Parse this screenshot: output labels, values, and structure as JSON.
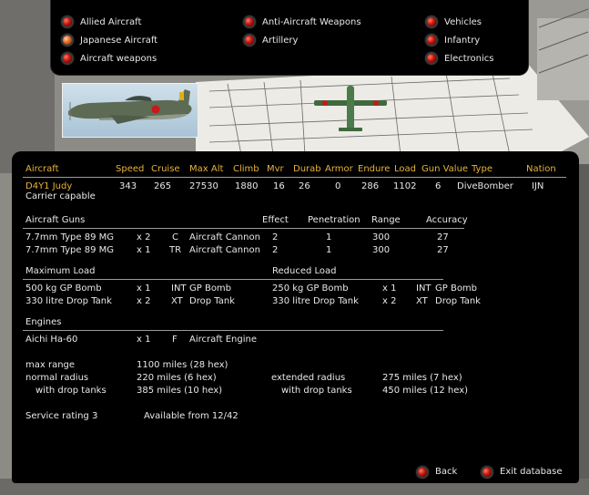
{
  "menu": {
    "items": [
      {
        "label": "Allied Aircraft",
        "selected": false
      },
      {
        "label": "Japanese Aircraft",
        "selected": true
      },
      {
        "label": "Aircraft weapons",
        "selected": false
      },
      {
        "label": "Anti-Aircraft Weapons",
        "selected": false
      },
      {
        "label": "Artillery",
        "selected": false
      },
      {
        "label": "Vehicles",
        "selected": false
      },
      {
        "label": "Infantry",
        "selected": false
      },
      {
        "label": "Electronics",
        "selected": false
      }
    ]
  },
  "stats": {
    "headers": [
      "Aircraft",
      "Speed",
      "Cruise",
      "Max Alt",
      "Climb",
      "Mvr",
      "Durab",
      "Armor",
      "Endure",
      "Load",
      "Gun Value",
      "Type",
      "Nation"
    ],
    "row": {
      "name": "D4Y1 Judy",
      "speed": "343",
      "cruise": "265",
      "max_alt": "27530",
      "climb": "1880",
      "mvr": "16",
      "durab": "26",
      "armor": "0",
      "endure": "286",
      "load": "1102",
      "gun_value": "6",
      "type": "DiveBomber",
      "nation": "IJN"
    },
    "note": "Carrier capable"
  },
  "guns": {
    "headers": [
      "Aircraft Guns",
      "Effect",
      "Penetration",
      "Range",
      "Accuracy"
    ],
    "rows": [
      {
        "name": "7.7mm Type 89 MG",
        "qty": "x 2",
        "code": "C",
        "kind": "Aircraft Cannon",
        "effect": "2",
        "pen": "1",
        "range": "300",
        "acc": "27"
      },
      {
        "name": "7.7mm Type 89 MG",
        "qty": "x 1",
        "code": "TR",
        "kind": "Aircraft Cannon",
        "effect": "2",
        "pen": "1",
        "range": "300",
        "acc": "27"
      }
    ]
  },
  "loads": {
    "max_header": "Maximum Load",
    "reduced_header": "Reduced Load",
    "max_rows": [
      {
        "name": "500 kg GP Bomb",
        "qty": "x 1",
        "code": "INT",
        "kind": "GP Bomb"
      },
      {
        "name": "330 litre Drop Tank",
        "qty": "x 2",
        "code": "XT",
        "kind": "Drop Tank"
      }
    ],
    "reduced_rows": [
      {
        "name": "250 kg GP Bomb",
        "qty": "x 1",
        "code": "INT",
        "kind": "GP Bomb"
      },
      {
        "name": "330 litre Drop Tank",
        "qty": "x 2",
        "code": "XT",
        "kind": "Drop Tank"
      }
    ]
  },
  "engines": {
    "header": "Engines",
    "rows": [
      {
        "name": "Aichi Ha-60",
        "qty": "x 1",
        "code": "F",
        "kind": "Aircraft Engine"
      }
    ]
  },
  "range": {
    "max_label": "max range",
    "max_value": "1100 miles (28 hex)",
    "normal_label": "normal radius",
    "normal_value": "220 miles (6 hex)",
    "normal_tanks_label": "with drop tanks",
    "normal_tanks_value": "385 miles (10 hex)",
    "ext_label": "extended radius",
    "ext_value": "275 miles (7 hex)",
    "ext_tanks_label": "with drop tanks",
    "ext_tanks_value": "450 miles (12 hex)"
  },
  "service": {
    "rating": "Service rating  3",
    "available": "Available from  12/42"
  },
  "footer": {
    "back": "Back",
    "exit": "Exit database"
  },
  "colors": {
    "header": "#e7b23a",
    "name": "#e7b23a",
    "led": "#c4140c"
  }
}
